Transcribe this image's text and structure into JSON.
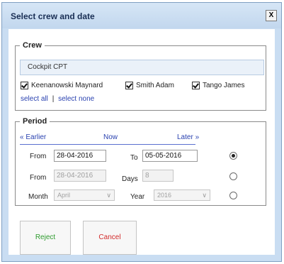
{
  "dialog": {
    "title": "Select crew and date",
    "close_label": "X"
  },
  "crew": {
    "legend": "Crew",
    "group": "Cockpit CPT",
    "members": [
      {
        "label": "Keenanowski Maynard",
        "checked": true
      },
      {
        "label": "Smith Adam",
        "checked": true
      },
      {
        "label": "Tango James",
        "checked": true
      }
    ],
    "select_all": "select all",
    "separator": "|",
    "select_none": "select none"
  },
  "period": {
    "legend": "Period",
    "earlier": "« Earlier",
    "now": "Now",
    "later": "Later »",
    "range": {
      "from_label": "From",
      "from_value": "28-04-2016",
      "to_label": "To",
      "to_value": "05-05-2016",
      "selected": true
    },
    "days": {
      "from_label": "From",
      "from_value": "28-04-2016",
      "days_label": "Days",
      "days_value": "8",
      "selected": false
    },
    "month": {
      "month_label": "Month",
      "month_value": "April",
      "year_label": "Year",
      "year_value": "2016",
      "selected": false
    }
  },
  "buttons": {
    "reject": "Reject",
    "cancel": "Cancel"
  },
  "colors": {
    "reject_text": "#2e9b2e",
    "cancel_text": "#d22a2a",
    "link": "#2a42b0"
  }
}
